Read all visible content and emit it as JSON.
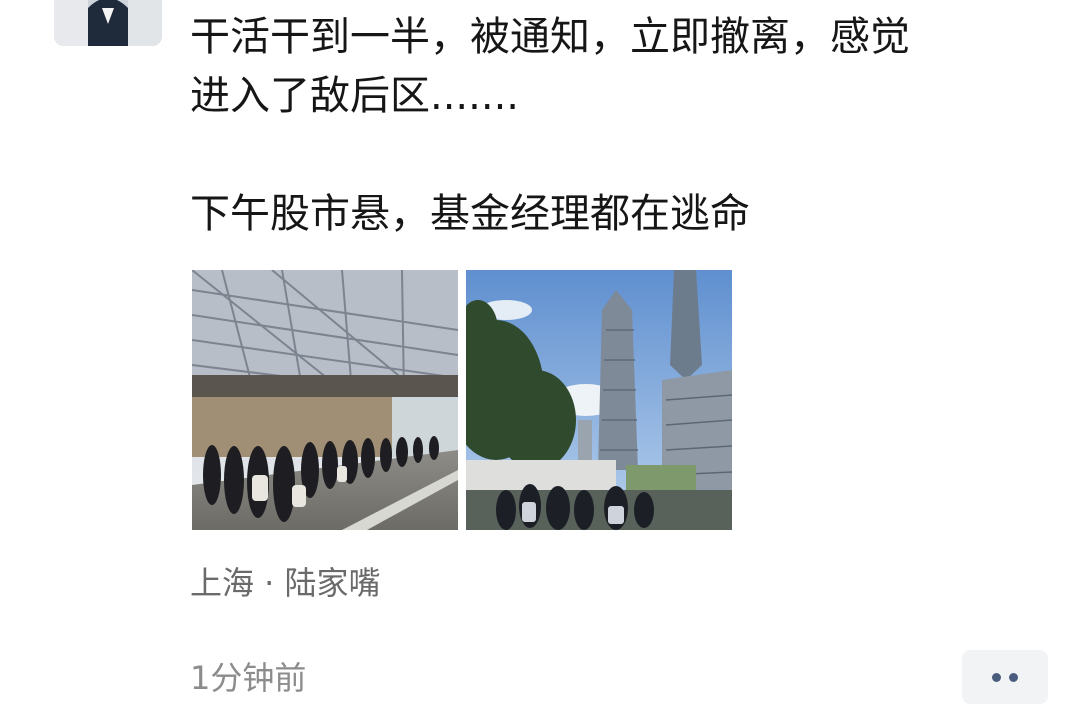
{
  "post": {
    "text": "干活干到一半，被通知，立即撤离，感觉\n进入了敌后区.......\n\n下午股市悬，基金经理都在逃命",
    "location": "上海 · 陆家嘴",
    "time": "1分钟前"
  },
  "icons": {
    "more": "more-dots-icon"
  },
  "colors": {
    "text": "#161616",
    "location": "#6a6a6a",
    "time": "#8c8c8c",
    "more_dots": "#4b5d7e",
    "more_bg": "#f2f3f5"
  }
}
